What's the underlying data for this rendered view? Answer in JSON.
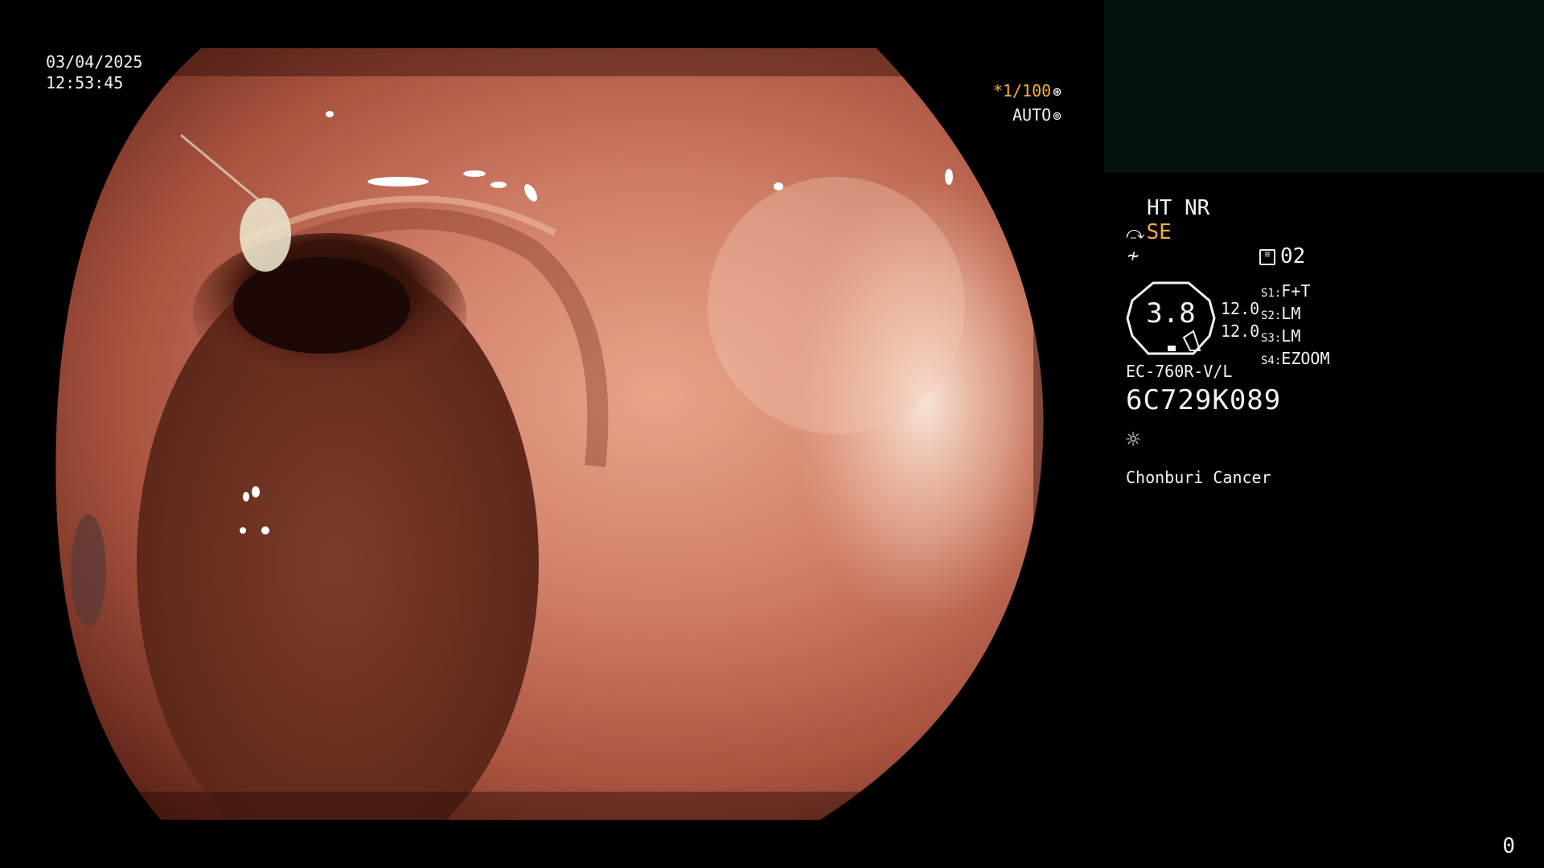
{
  "datetime": {
    "date": "03/04/2025",
    "time": "12:53:45"
  },
  "shutter": {
    "speed": "*1/100",
    "iris": "AUTO",
    "speed_icon": "aperture-icon",
    "iris_icon": "iris-icon"
  },
  "panel": {
    "modes": "HT NR",
    "se_label": "SE",
    "preset_value": "02",
    "zoom_value": "3.8",
    "value_1": "12.0",
    "value_2": "12.0",
    "switches": [
      {
        "key": "S1:",
        "val": "F+T"
      },
      {
        "key": "S2:",
        "val": "LM"
      },
      {
        "key": "S3:",
        "val": "LM"
      },
      {
        "key": "S4:",
        "val": "EZOOM"
      }
    ],
    "scope_model": "EC-760R-V/L",
    "serial_number": "6C729K089",
    "light_icon": "sun-icon",
    "hospital": "Chonburi Cancer"
  },
  "counter": "0",
  "colors": {
    "accent": "#f4b13a",
    "text": "#f2f2f2",
    "background": "#000000"
  }
}
